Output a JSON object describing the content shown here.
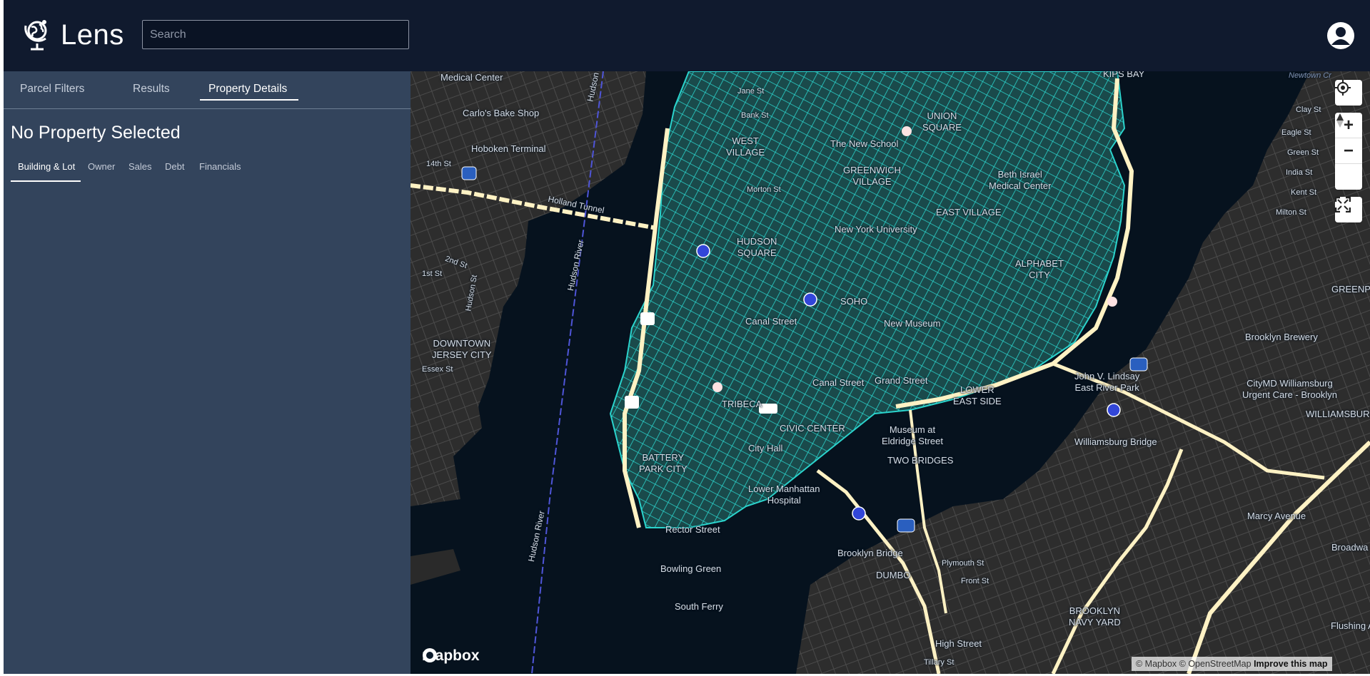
{
  "app": {
    "name": "Lens"
  },
  "search": {
    "placeholder": "Search",
    "value": ""
  },
  "tabs": [
    {
      "label": "Parcel Filters"
    },
    {
      "label": "Results"
    },
    {
      "label": "Property Details",
      "active": true
    }
  ],
  "property": {
    "title": "No Property Selected"
  },
  "subtabs": [
    {
      "label": "Building & Lot",
      "active": true
    },
    {
      "label": "Owner"
    },
    {
      "label": "Sales"
    },
    {
      "label": "Debt"
    },
    {
      "label": "Financials"
    }
  ],
  "map": {
    "controls": {
      "zoom_in": "+",
      "zoom_out": "−"
    },
    "labels": {
      "medical_center": "Medical Center",
      "carlos": "Carlo's Bake Shop",
      "hoboken": "Hoboken Terminal",
      "st14": "14th St",
      "holland": "Holland Tunnel",
      "hudson_river_1": "Hudson River",
      "hudson_river_2": "Hudson River",
      "hudson_river_3": "Hudson",
      "st2": "2nd St",
      "st1": "1st St",
      "hudson_st": "Hudson St",
      "downtown_jc": "DOWNTOWN\nJERSEY CITY",
      "essex": "Essex St",
      "jane": "Jane St",
      "bank": "Bank St",
      "west_village": "WEST\nVILLAGE",
      "new_school": "The New School",
      "union_sq": "UNION\nSQUARE",
      "greenwich": "GREENWICH\nVILLAGE",
      "beth_israel": "Beth Israel\nMedical Center",
      "morton": "Morton St",
      "nyu": "New York University",
      "east_village": "EAST VILLAGE",
      "hudson_sq": "HUDSON\nSQUARE",
      "alphabet": "ALPHABET\nCITY",
      "soho": "SOHO",
      "canal1": "Canal Street",
      "new_museum": "New Museum",
      "grand_st": "Grand Street",
      "canal2": "Canal Street",
      "tribeca": "TRIBECA",
      "lower_east": "LOWER\nEAST SIDE",
      "civic": "CIVIC CENTER",
      "museum_eldridge": "Museum at\nEldridge Street",
      "city_hall": "City Hall",
      "two_bridges": "TWO BRIDGES",
      "battery": "BATTERY\nPARK CITY",
      "lm_hospital": "Lower Manhattan\nHospital",
      "rector": "Rector Street",
      "bowling": "Bowling Green",
      "south_ferry": "South Ferry",
      "brooklyn_bridge": "Brooklyn Bridge",
      "dumbo": "DUMBO",
      "plymouth": "Plymouth St",
      "front": "Front St",
      "high_street": "High Street",
      "tillary": "Tillary St",
      "bk_navy": "BROOKLYN\nNAVY YARD",
      "john_lindsay": "John V. Lindsay\nEast River Park",
      "williamsburg_br": "Williamsburg Bridge",
      "brooklyn_brewery": "Brooklyn Brewery",
      "citymd": "CityMD Williamsburg\nUrgent Care - Brooklyn",
      "williamsburg": "WILLIAMSBURG",
      "marcy": "Marcy Avenue",
      "greenpoint": "GREENPOI",
      "newtown": "Newtown Cr",
      "kips_bay": "KIPS BAY",
      "clay": "Clay St",
      "eagle": "Eagle St",
      "green": "Green St",
      "india": "India St",
      "kent": "Kent St",
      "milton": "Milton St",
      "broadway": "Broadwa",
      "flushing": "Flushing A"
    },
    "attribution": {
      "mapbox": "© Mapbox",
      "osm": "© OpenStreetMap",
      "improve": "Improve this map"
    },
    "logo_text": "mapbox",
    "colors": {
      "water": "#06121e",
      "land": "#2e2e2e",
      "parcel": "#2bd3cc",
      "highway": "#fff2c4"
    }
  }
}
